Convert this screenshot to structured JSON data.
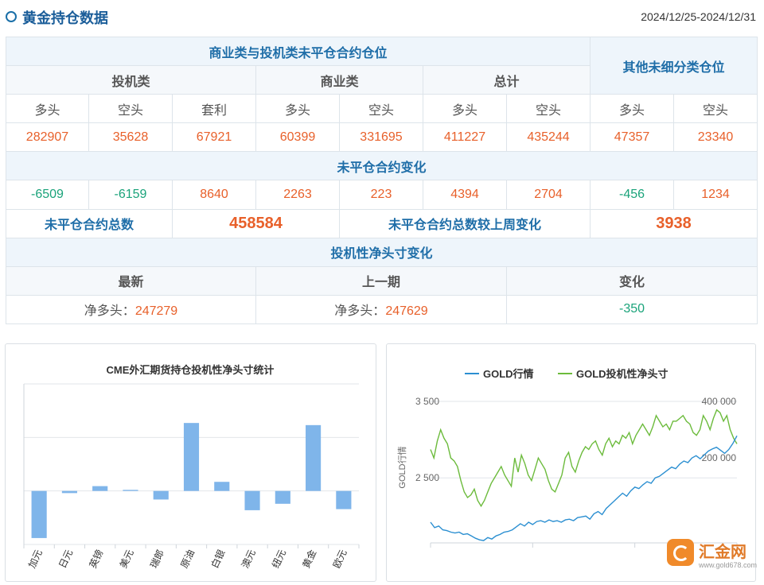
{
  "header": {
    "title": "黄金持仓数据",
    "date_range": "2024/12/25-2024/12/31"
  },
  "table": {
    "group_title": "商业类与投机类未平仓合约仓位",
    "other_title": "其他未细分类仓位",
    "speculative": "投机类",
    "commercial": "商业类",
    "total": "总计",
    "long": "多头",
    "short": "空头",
    "arb": "套利",
    "values": [
      "282907",
      "35628",
      "67921",
      "60399",
      "331695",
      "411227",
      "435244",
      "47357",
      "23340"
    ],
    "change_title": "未平仓合约变化",
    "changes": [
      "-6509",
      "-6159",
      "8640",
      "2263",
      "223",
      "4394",
      "2704",
      "-456",
      "1234"
    ],
    "oi_total_label": "未平仓合约总数",
    "oi_total": "458584",
    "oi_change_label": "未平仓合约总数较上周变化",
    "oi_change": "3938",
    "net_title": "投机性净头寸变化",
    "latest": "最新",
    "previous": "上一期",
    "change": "变化",
    "net_prefix": "净多头：",
    "net_latest": "247279",
    "net_previous": "247629",
    "net_change": "-350"
  },
  "chart_data": [
    {
      "type": "bar",
      "title": "CME外汇期货持仓投机性净头寸统计",
      "categories": [
        "加元",
        "日元",
        "英镑",
        "美元",
        "瑞郎",
        "原油",
        "白银",
        "澳元",
        "纽元",
        "黄金",
        "欧元"
      ],
      "values": [
        -88,
        -4,
        9,
        2,
        -16,
        127,
        17,
        -36,
        -24,
        123,
        -34
      ],
      "ylim": [
        -100,
        200
      ],
      "grid": true,
      "color": "#7fb5ea"
    },
    {
      "type": "line",
      "legend": [
        "GOLD行情",
        "GOLD投机性净头寸"
      ],
      "ylabel": "GOLD行情",
      "left_axis": {
        "ticks": [
          "3 500",
          "2 500"
        ],
        "tick_values": [
          3500,
          2500
        ],
        "range": [
          1650,
          3500
        ]
      },
      "right_axis": {
        "ticks": [
          "400 000",
          "200 000"
        ],
        "tick_values": [
          400000,
          200000
        ],
        "range": [
          -100000,
          400000
        ]
      },
      "series": [
        {
          "name": "GOLD行情",
          "color": "#2b8fd1",
          "values": [
            1920,
            1850,
            1870,
            1820,
            1810,
            1790,
            1780,
            1790,
            1760,
            1770,
            1740,
            1710,
            1690,
            1680,
            1720,
            1700,
            1740,
            1760,
            1790,
            1800,
            1820,
            1860,
            1900,
            1870,
            1920,
            1890,
            1930,
            1940,
            1920,
            1950,
            1930,
            1940,
            1920,
            1950,
            1960,
            1940,
            1980,
            1990,
            2000,
            1960,
            2030,
            2060,
            2020,
            2100,
            2150,
            2200,
            2250,
            2300,
            2260,
            2330,
            2380,
            2360,
            2410,
            2450,
            2430,
            2500,
            2520,
            2560,
            2600,
            2640,
            2620,
            2680,
            2720,
            2700,
            2760,
            2790,
            2750,
            2800,
            2850,
            2880,
            2900,
            2860,
            2820,
            2870,
            2950,
            3050
          ]
        },
        {
          "name": "GOLD投机性净头寸",
          "color": "#6cbb3c",
          "values": [
            230000,
            200000,
            260000,
            300000,
            270000,
            250000,
            200000,
            190000,
            170000,
            120000,
            80000,
            60000,
            70000,
            90000,
            50000,
            30000,
            50000,
            80000,
            110000,
            130000,
            150000,
            170000,
            140000,
            120000,
            100000,
            200000,
            150000,
            210000,
            180000,
            140000,
            120000,
            160000,
            200000,
            180000,
            160000,
            120000,
            90000,
            80000,
            110000,
            140000,
            200000,
            220000,
            170000,
            150000,
            190000,
            220000,
            240000,
            230000,
            250000,
            260000,
            230000,
            210000,
            250000,
            270000,
            240000,
            260000,
            250000,
            280000,
            270000,
            290000,
            250000,
            280000,
            300000,
            320000,
            300000,
            280000,
            310000,
            350000,
            330000,
            310000,
            320000,
            300000,
            330000,
            330000,
            340000,
            350000,
            330000,
            320000,
            290000,
            280000,
            300000,
            350000,
            330000,
            300000,
            340000,
            370000,
            360000,
            330000,
            350000,
            300000,
            270000,
            250000
          ]
        }
      ]
    }
  ],
  "watermark": {
    "name": "汇金网",
    "site": "www.gold678.com"
  }
}
